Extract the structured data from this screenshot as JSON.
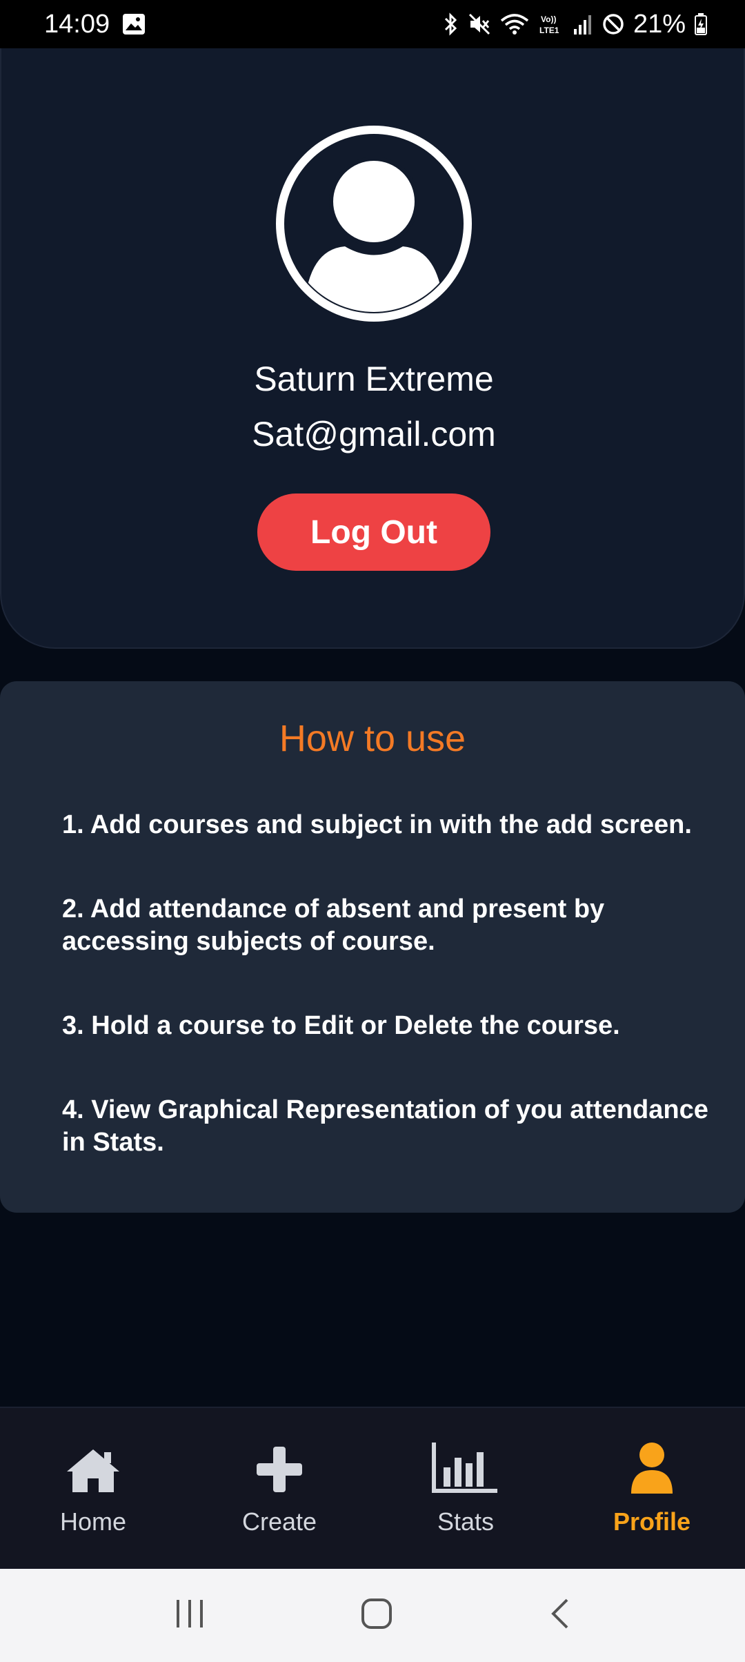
{
  "status_bar": {
    "time": "14:09",
    "battery": "21%"
  },
  "profile": {
    "name": "Saturn Extreme",
    "email": "Sat@gmail.com",
    "logout_label": "Log Out",
    "logout_color": "#ee4244"
  },
  "howto": {
    "title": "How to use",
    "title_color": "#f47a25",
    "steps": [
      "1. Add courses and subject in with the add screen.",
      "2. Add attendance of absent and present by accessing subjects of course.",
      "3. Hold a course to Edit or Delete the course.",
      "4. View Graphical Representation of you attendance in Stats."
    ]
  },
  "nav": {
    "items": [
      {
        "label": "Home",
        "icon": "home-icon"
      },
      {
        "label": "Create",
        "icon": "plus-icon"
      },
      {
        "label": "Stats",
        "icon": "bar-chart-icon"
      },
      {
        "label": "Profile",
        "icon": "user-icon"
      }
    ],
    "active": "Profile",
    "active_color": "#f9a31a"
  },
  "system_nav": {
    "buttons": [
      "recent-apps-icon",
      "home-button-icon",
      "back-icon"
    ]
  }
}
